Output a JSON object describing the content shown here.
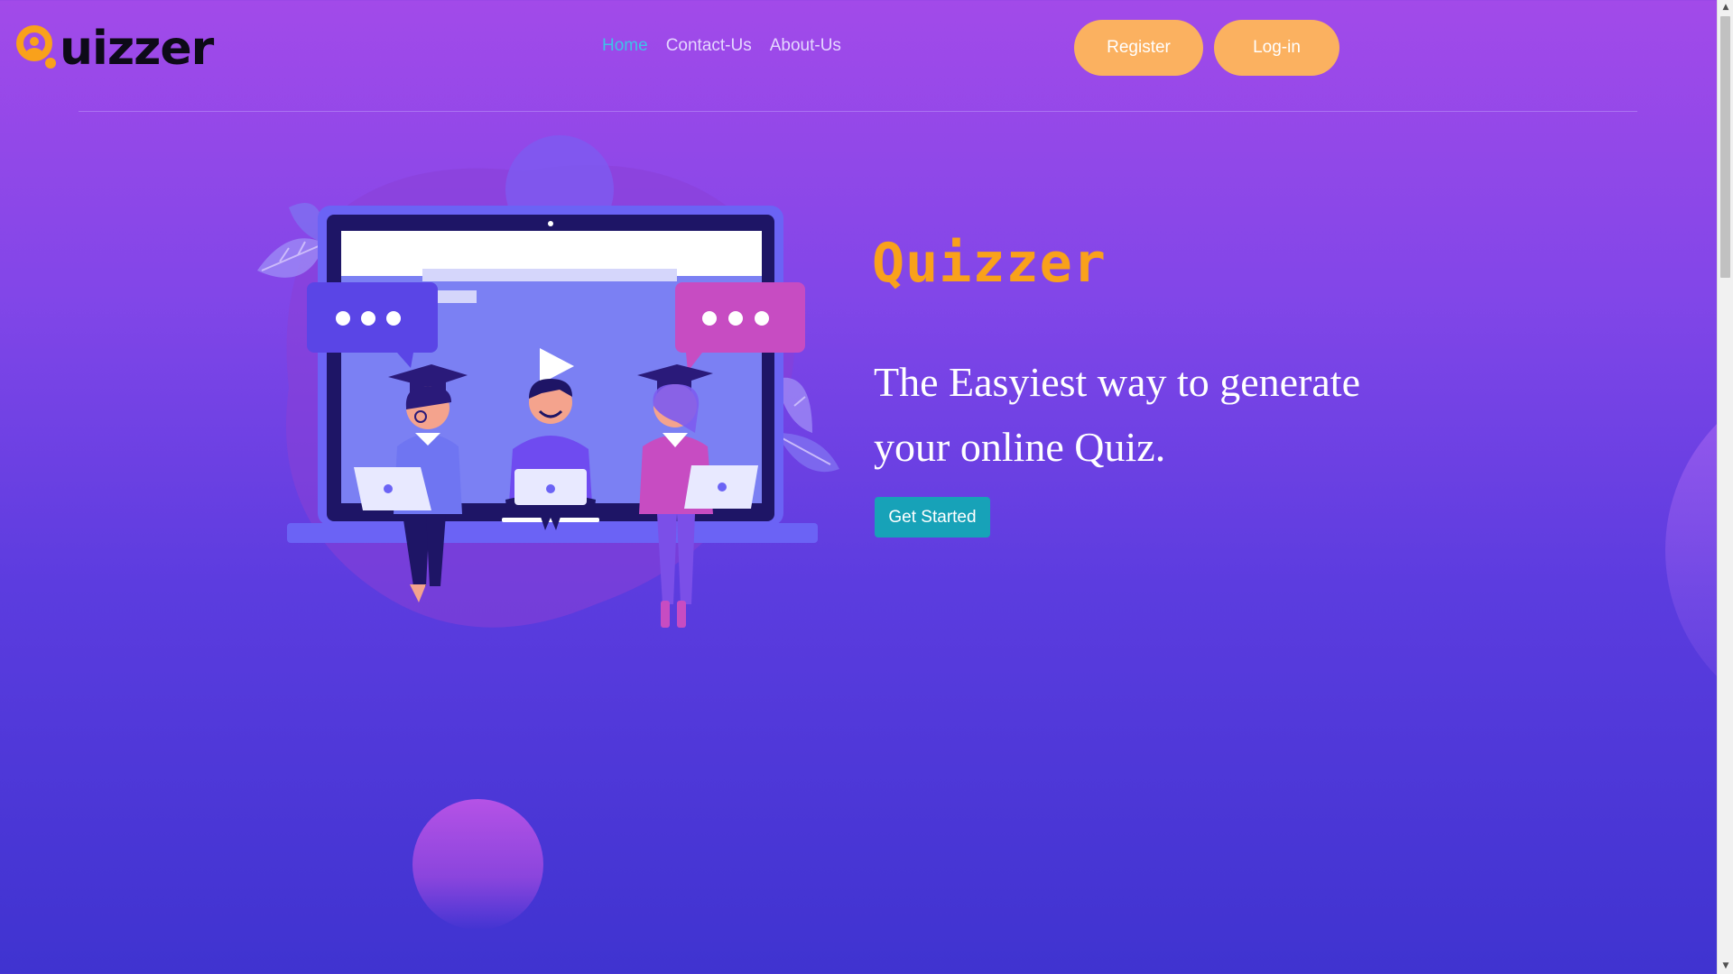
{
  "logo": {
    "letter": "Q",
    "text": "uizzer"
  },
  "nav": [
    {
      "label": "Home",
      "active": true
    },
    {
      "label": "Contact-Us",
      "active": false
    },
    {
      "label": "About-Us",
      "active": false
    }
  ],
  "auth": {
    "register_label": "Register",
    "login_label": "Log-in"
  },
  "hero": {
    "title": "Quizzer",
    "tagline": "The Easyiest way to generate your online Quiz.",
    "cta_label": "Get Started"
  },
  "colors": {
    "accent_orange": "#f9a11b",
    "pill_button": "#fbb160",
    "cta_teal": "#17a2b8",
    "nav_active": "#3ec3e8"
  },
  "icons": [
    "play-icon",
    "speech-bubble-icon",
    "scroll-up-arrow-icon",
    "scroll-down-arrow-icon"
  ]
}
